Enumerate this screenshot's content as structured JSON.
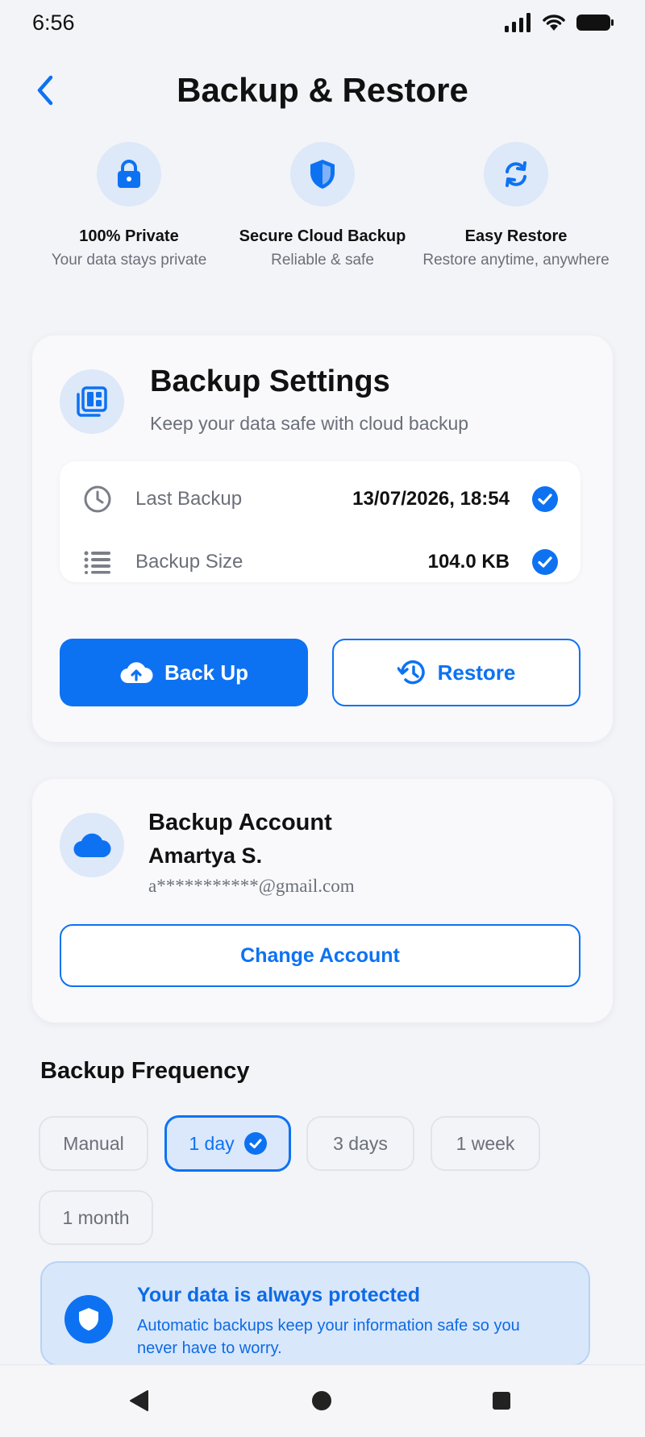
{
  "status_bar": {
    "time": "6:56"
  },
  "header": {
    "title": "Backup & Restore"
  },
  "features": [
    {
      "title": "100% Private",
      "desc": "Your data stays private",
      "icon": "lock-icon"
    },
    {
      "title": "Secure Cloud Backup",
      "desc": "Reliable & safe",
      "icon": "shield-icon"
    },
    {
      "title": "Easy Restore",
      "desc": "Restore anytime, anywhere",
      "icon": "sync-icon"
    }
  ],
  "settings": {
    "title": "Backup Settings",
    "subtitle": "Keep your data safe with cloud backup",
    "last_backup_label": "Last Backup",
    "last_backup_value": "13/07/2026, 18:54",
    "size_label": "Backup Size",
    "size_value": "104.0 KB",
    "backup_button": "Back Up",
    "restore_button": "Restore"
  },
  "account": {
    "heading": "Backup Account",
    "name": "Amartya S.",
    "email": "a***********@gmail.com",
    "change_button": "Change Account"
  },
  "frequency": {
    "title": "Backup Frequency",
    "options": [
      "Manual",
      "1 day",
      "3 days",
      "1 week",
      "1 month"
    ],
    "selected": "1 day"
  },
  "banner": {
    "title": "Your data is always protected",
    "text": "Automatic backups keep your information safe so you never have to worry."
  },
  "colors": {
    "accent": "#0d72f2",
    "background": "#f3f4f8",
    "icon_bg": "#dde8f8"
  }
}
